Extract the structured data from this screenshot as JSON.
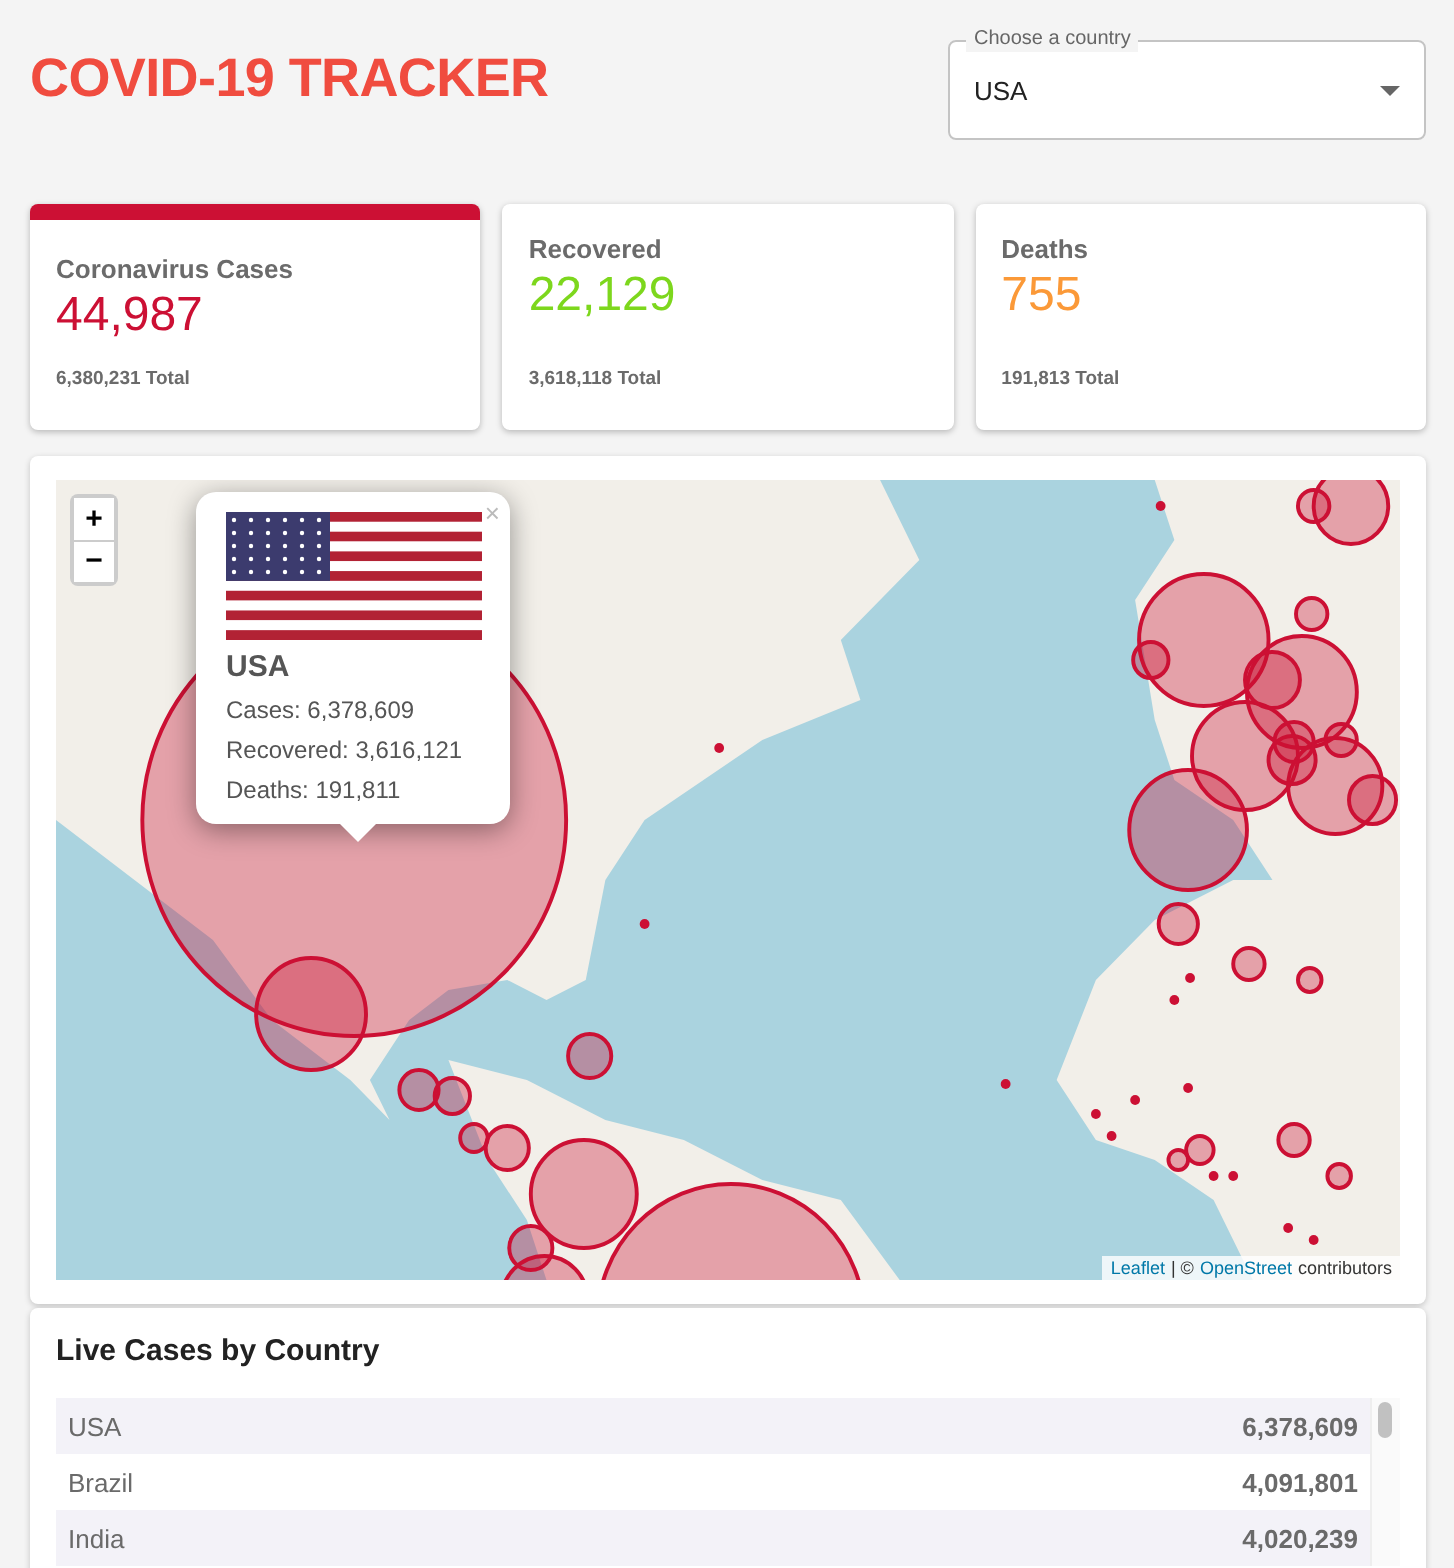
{
  "header": {
    "title": "COVID-19 TRACKER",
    "country_select": {
      "label": "Choose a country",
      "value": "USA"
    }
  },
  "stats": [
    {
      "title": "Coronavirus Cases",
      "value": "44,987",
      "total": "6,380,231 Total",
      "color": "#cc1034",
      "selected": true
    },
    {
      "title": "Recovered",
      "value": "22,129",
      "total": "3,618,118 Total",
      "color": "#7dd71d",
      "selected": false
    },
    {
      "title": "Deaths",
      "value": "755",
      "total": "191,813 Total",
      "color": "#fb9938",
      "selected": false
    }
  ],
  "map": {
    "zoom_in": "+",
    "zoom_out": "−",
    "popup": {
      "close": "×",
      "country": "USA",
      "lines": [
        "Cases: 6,378,609",
        "Recovered: 3,616,121",
        "Deaths: 191,811"
      ]
    },
    "attribution": {
      "link": "Leaflet",
      "separator": "| ©",
      "source": "OpenStreet",
      "suffix": "contributors"
    }
  },
  "table": {
    "title": "Live Cases by Country",
    "rows": [
      {
        "country": "USA",
        "cases": "6,378,609"
      },
      {
        "country": "Brazil",
        "cases": "4,091,801"
      },
      {
        "country": "India",
        "cases": "4,020,239"
      }
    ]
  }
}
